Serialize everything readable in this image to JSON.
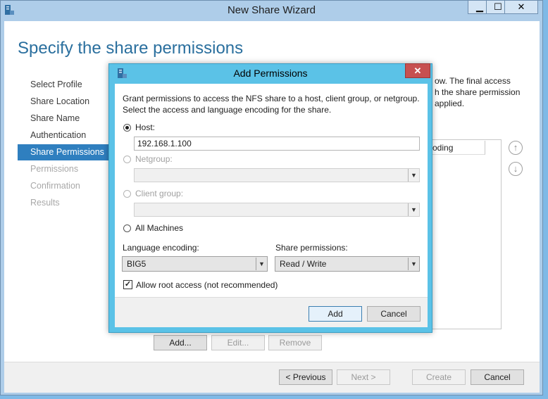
{
  "window": {
    "title": "New Share Wizard",
    "minimize": "▁",
    "maximize": "☐",
    "close": "✕",
    "icon": "server-manager-icon"
  },
  "page": {
    "heading": "Specify the share permissions",
    "steps": [
      "Select Profile",
      "Share Location",
      "Share Name",
      "Authentication",
      "Share Permissions",
      "Permissions",
      "Confirmation",
      "Results"
    ],
    "active_step": "Share Permissions",
    "desc_fragments": [
      "ow. The final access",
      "h the share permission",
      "applied."
    ],
    "table_col_fragment": "oding",
    "move_up_icon": "↑",
    "move_down_icon": "↓",
    "add": "Add...",
    "edit": "Edit...",
    "remove": "Remove",
    "previous": "< Previous",
    "next": "Next >",
    "create": "Create",
    "cancel": "Cancel"
  },
  "dialog": {
    "title": "Add Permissions",
    "close": "✕",
    "intro_1": "Grant permissions to access the NFS share to a host, client group, or netgroup.",
    "intro_2": "Select the access and language encoding for the share.",
    "host_label": "Host:",
    "host_value": "192.168.1.100",
    "netgroup_label": "Netgroup:",
    "client_group_label": "Client group:",
    "all_machines_label": "All Machines",
    "language_label": "Language encoding:",
    "language_value": "BIG5",
    "permissions_label": "Share permissions:",
    "permissions_value": "Read / Write",
    "root_access_label": "Allow root access (not recommended)",
    "root_access_check": "✓",
    "add_button": "Add",
    "cancel_button": "Cancel",
    "dropdown_arrow": "▼"
  },
  "colors": {
    "accent": "#2f7fbf",
    "dialog_frame": "#5bc2e7",
    "close_red": "#c75050"
  }
}
